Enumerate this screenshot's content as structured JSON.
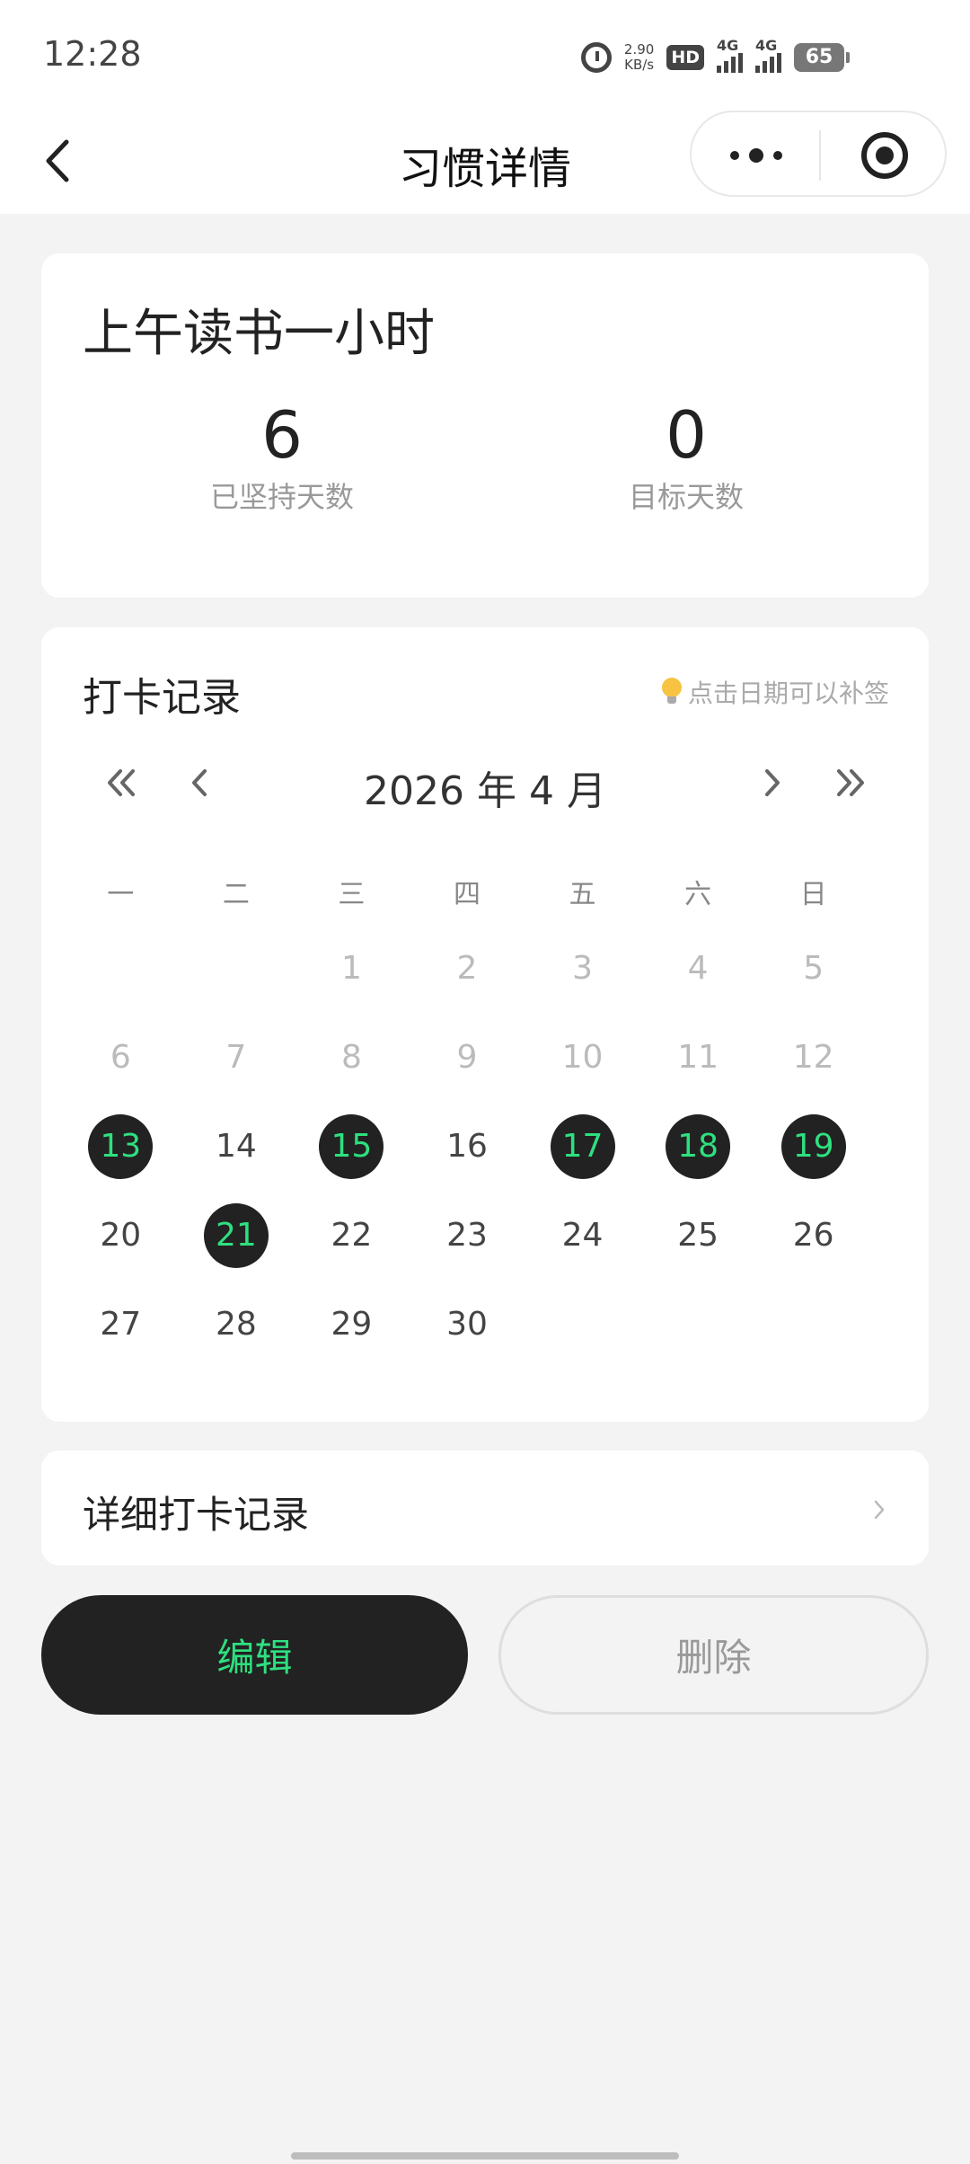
{
  "status_bar": {
    "time": "12:28",
    "net_speed_value": "2.90",
    "net_speed_unit": "KB/s",
    "hd_label": "HD",
    "signal1_label": "4G",
    "signal2_label": "4G",
    "battery": "65"
  },
  "nav": {
    "title": "习惯详情"
  },
  "habit": {
    "name": "上午读书一小时",
    "persisted_days_value": "6",
    "persisted_days_label": "已坚持天数",
    "target_days_value": "0",
    "target_days_label": "目标天数"
  },
  "calendar": {
    "title": "打卡记录",
    "tip": "点击日期可以补签",
    "month_label": "2026 年 4 月",
    "weekdays": [
      "一",
      "二",
      "三",
      "四",
      "五",
      "六",
      "日"
    ],
    "days": [
      {
        "label": "",
        "state": "empty"
      },
      {
        "label": "",
        "state": "empty"
      },
      {
        "label": "1",
        "state": "other"
      },
      {
        "label": "2",
        "state": "other"
      },
      {
        "label": "3",
        "state": "other"
      },
      {
        "label": "4",
        "state": "other"
      },
      {
        "label": "5",
        "state": "other"
      },
      {
        "label": "6",
        "state": "other"
      },
      {
        "label": "7",
        "state": "other"
      },
      {
        "label": "8",
        "state": "other"
      },
      {
        "label": "9",
        "state": "other"
      },
      {
        "label": "10",
        "state": "other"
      },
      {
        "label": "11",
        "state": "other"
      },
      {
        "label": "12",
        "state": "other"
      },
      {
        "label": "13",
        "state": "checked"
      },
      {
        "label": "14",
        "state": "normal"
      },
      {
        "label": "15",
        "state": "checked"
      },
      {
        "label": "16",
        "state": "normal"
      },
      {
        "label": "17",
        "state": "checked"
      },
      {
        "label": "18",
        "state": "checked"
      },
      {
        "label": "19",
        "state": "checked"
      },
      {
        "label": "20",
        "state": "normal"
      },
      {
        "label": "21",
        "state": "checked"
      },
      {
        "label": "22",
        "state": "normal"
      },
      {
        "label": "23",
        "state": "normal"
      },
      {
        "label": "24",
        "state": "normal"
      },
      {
        "label": "25",
        "state": "normal"
      },
      {
        "label": "26",
        "state": "normal"
      },
      {
        "label": "27",
        "state": "normal"
      },
      {
        "label": "28",
        "state": "normal"
      },
      {
        "label": "29",
        "state": "normal"
      },
      {
        "label": "30",
        "state": "normal"
      }
    ]
  },
  "detail": {
    "label": "详细打卡记录"
  },
  "actions": {
    "edit_label": "编辑",
    "delete_label": "删除"
  },
  "colors": {
    "accent": "#2ee07f",
    "dark": "#222222",
    "background": "#f3f3f3"
  }
}
